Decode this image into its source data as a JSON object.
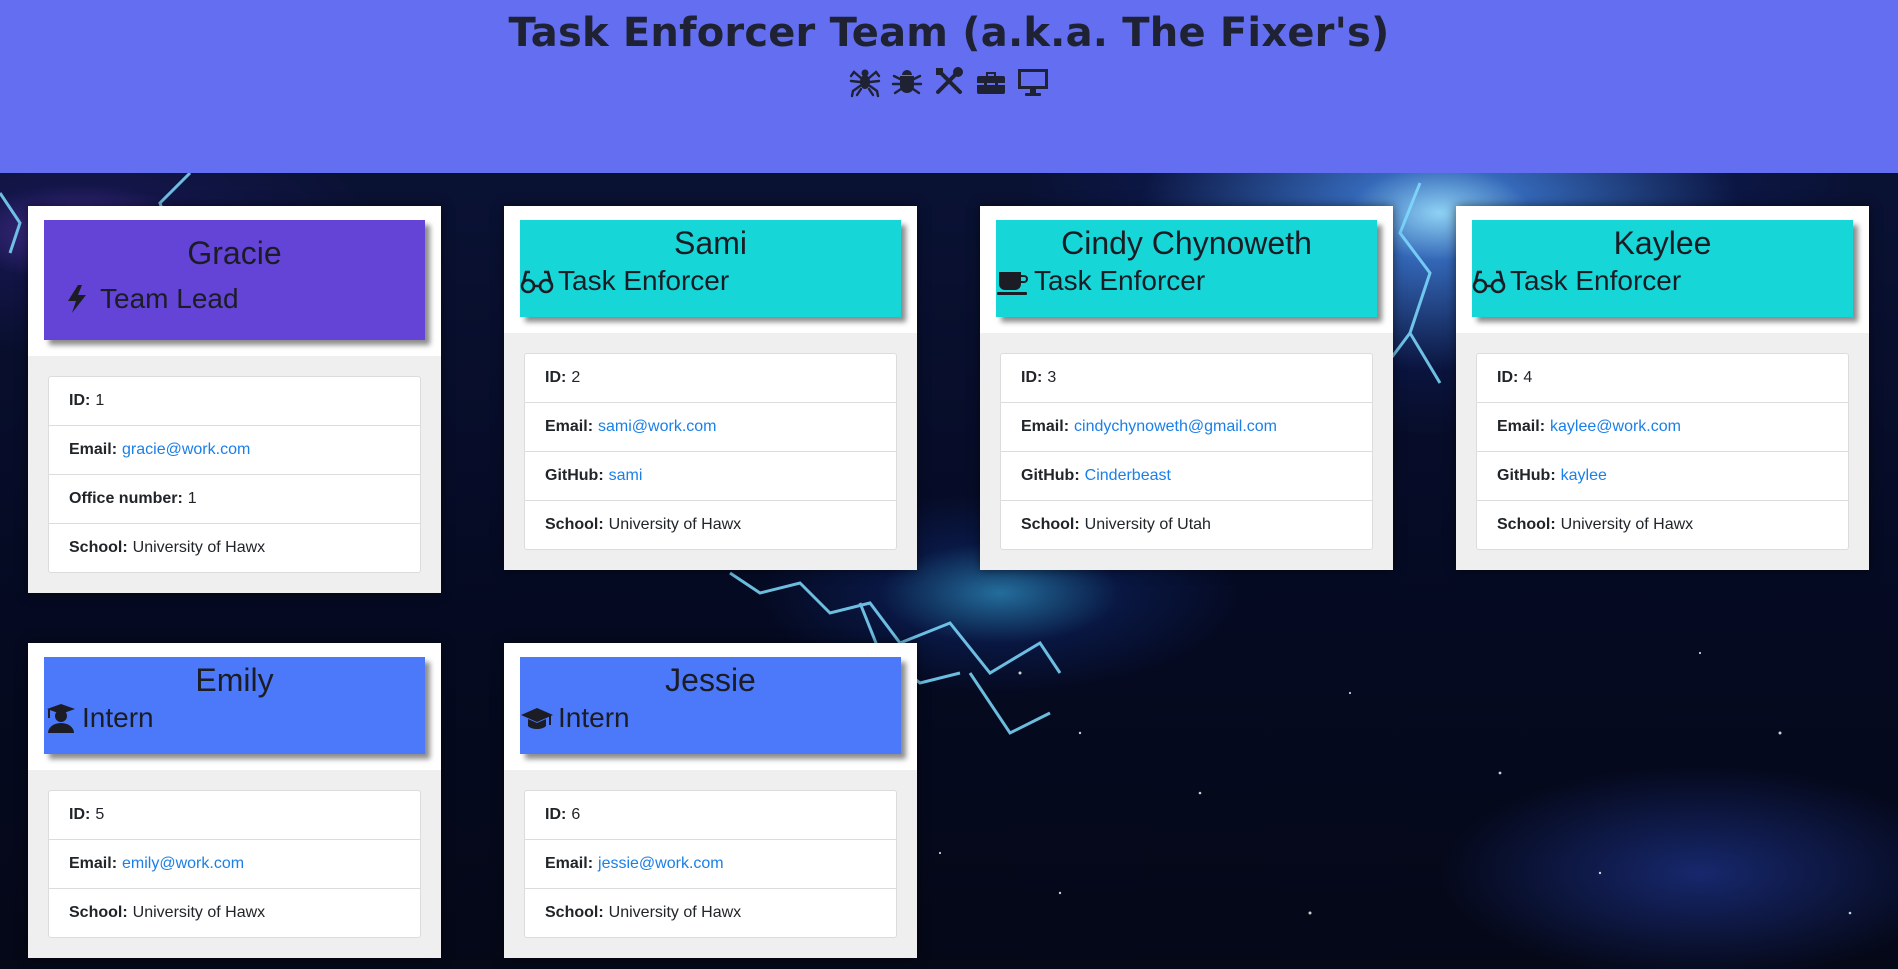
{
  "header": {
    "title": "Task Enforcer Team (a.k.a. The Fixer's)",
    "icons": [
      "spider-icon",
      "bug-icon",
      "tools-icon",
      "toolbox-icon",
      "desktop-icon"
    ]
  },
  "labels": {
    "id": "ID:",
    "email": "Email:",
    "office": "Office number:",
    "github": "GitHub:",
    "school": "School:"
  },
  "colors": {
    "header": "#636ef0",
    "lead": "#6344d6",
    "enforcer": "#16d6d8",
    "intern": "#4b79fa",
    "link": "#1a7fe8"
  },
  "cards": [
    {
      "name": "Gracie",
      "role": "Team Lead",
      "role_icon": "bolt-icon",
      "id": "1",
      "email": "gracie@work.com",
      "office": "1",
      "school": "University of Hawx"
    },
    {
      "name": "Sami",
      "role": "Task Enforcer",
      "role_icon": "glasses-icon",
      "id": "2",
      "email": "sami@work.com",
      "github": "sami",
      "school": "University of Hawx"
    },
    {
      "name": "Cindy Chynoweth",
      "role": "Task Enforcer",
      "role_icon": "coffee-icon",
      "id": "3",
      "email": "cindychynoweth@gmail.com",
      "github": "Cinderbeast",
      "school": "University of Utah"
    },
    {
      "name": "Kaylee",
      "role": "Task Enforcer",
      "role_icon": "glasses-icon",
      "id": "4",
      "email": "kaylee@work.com",
      "github": "kaylee",
      "school": "University of Hawx"
    },
    {
      "name": "Emily",
      "role": "Intern",
      "role_icon": "graduate-icon",
      "id": "5",
      "email": "emily@work.com",
      "school": "University of Hawx"
    },
    {
      "name": "Jessie",
      "role": "Intern",
      "role_icon": "graduation-cap-icon",
      "id": "6",
      "email": "jessie@work.com",
      "school": "University of Hawx"
    }
  ]
}
